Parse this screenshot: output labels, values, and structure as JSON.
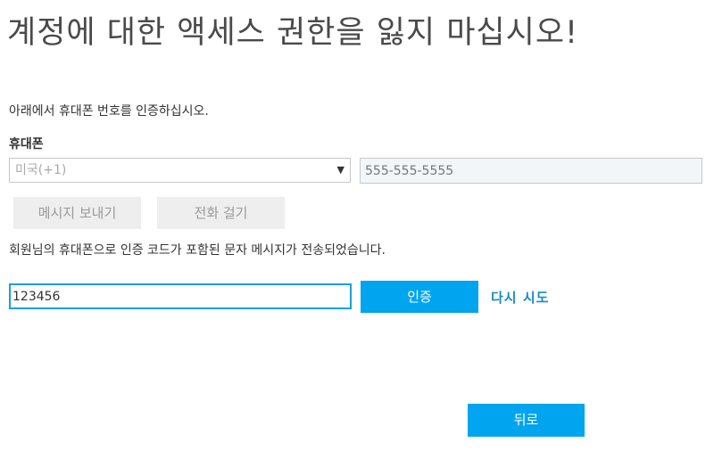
{
  "title": "계정에 대한 액세스 권한을 잃지 마십시오!",
  "instruction": "아래에서 휴대폰 번호를 인증하십시오.",
  "phone": {
    "label": "휴대폰",
    "country_value": "미국(+1)",
    "number_placeholder": "555-555-5555"
  },
  "buttons": {
    "send_sms": "메시지 보내기",
    "call": "전화 걸기",
    "verify": "인증",
    "retry": "다시 시도",
    "back": "뒤로"
  },
  "sent_message": "회원님의 휴대폰으로 인증 코드가 포함된 문자 메시지가 전송되었습니다.",
  "code_input_value": "123456",
  "colors": {
    "accent": "#00a4ef",
    "link": "#1a8bc8",
    "focus_border": "#1aa0d8",
    "disabled_button_bg": "#eeeeee"
  }
}
